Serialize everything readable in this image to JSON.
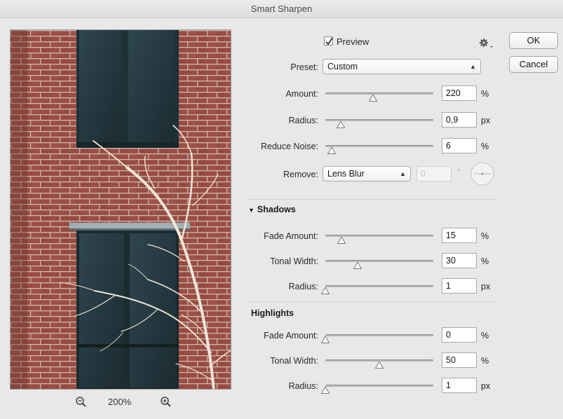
{
  "window": {
    "title": "Smart Sharpen"
  },
  "buttons": {
    "ok": "OK",
    "cancel": "Cancel"
  },
  "preview_toggle": {
    "label": "Preview",
    "checked": true
  },
  "settings_icon": "gear-icon",
  "preset": {
    "label": "Preset:",
    "value": "Custom"
  },
  "sharpen": {
    "amount": {
      "label": "Amount:",
      "value": "220",
      "unit": "%",
      "level": 0.44
    },
    "radius": {
      "label": "Radius:",
      "value": "0,9",
      "unit": "px",
      "level": 0.14
    },
    "reduce_noise": {
      "label": "Reduce Noise:",
      "value": "6",
      "unit": "%",
      "level": 0.06
    },
    "remove": {
      "label": "Remove:",
      "value": "Lens Blur",
      "angle_value": "0",
      "angle_unit": "°"
    }
  },
  "shadows": {
    "title": "Shadows",
    "fade_amount": {
      "label": "Fade Amount:",
      "value": "15",
      "unit": "%",
      "level": 0.15
    },
    "tonal_width": {
      "label": "Tonal Width:",
      "value": "30",
      "unit": "%",
      "level": 0.3
    },
    "radius": {
      "label": "Radius:",
      "value": "1",
      "unit": "px",
      "level": 0.0
    }
  },
  "highlights": {
    "title": "Highlights",
    "fade_amount": {
      "label": "Fade Amount:",
      "value": "0",
      "unit": "%",
      "level": 0.0
    },
    "tonal_width": {
      "label": "Tonal Width:",
      "value": "50",
      "unit": "%",
      "level": 0.5
    },
    "radius": {
      "label": "Radius:",
      "value": "1",
      "unit": "px",
      "level": 0.0
    }
  },
  "zoom": {
    "level": "200%",
    "zoom_out_icon": "zoom-out-icon",
    "zoom_in_icon": "zoom-in-icon"
  }
}
